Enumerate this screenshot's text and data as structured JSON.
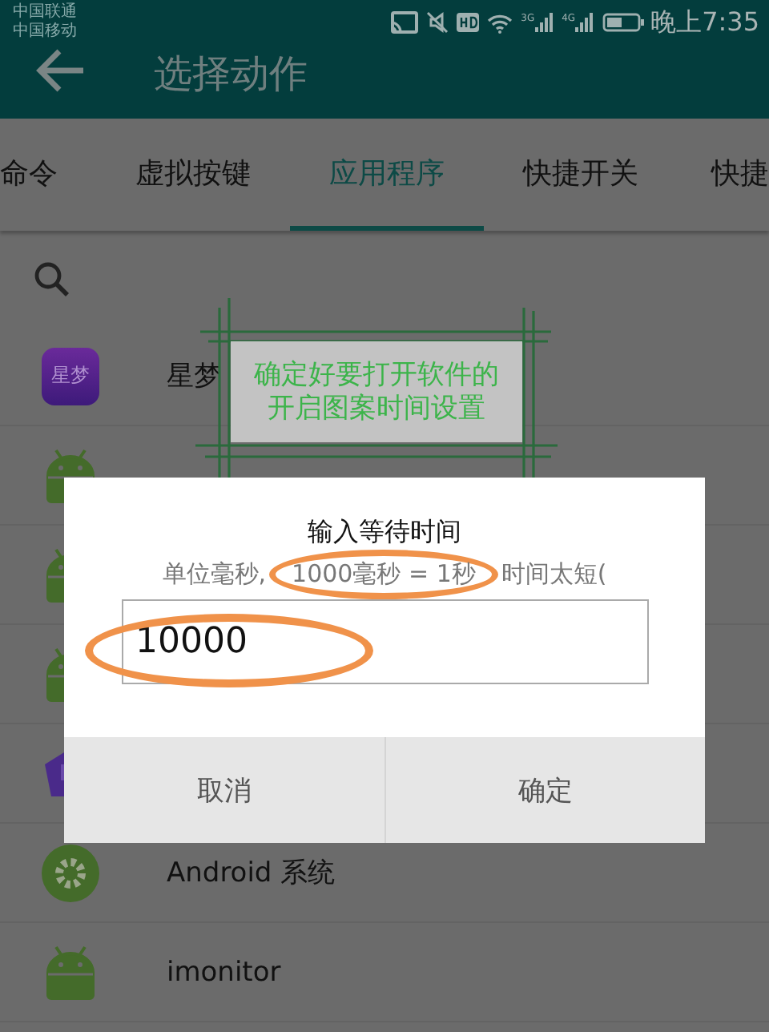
{
  "status_bar": {
    "carriers": [
      "中国联通",
      "中国移动"
    ],
    "network_labels": [
      "3G",
      "4G"
    ],
    "time": "晚上7:35"
  },
  "app_bar": {
    "title": "选择动作"
  },
  "tabs": [
    {
      "label": "命令",
      "selected": false
    },
    {
      "label": "虚拟按键",
      "selected": false
    },
    {
      "label": "应用程序",
      "selected": true
    },
    {
      "label": "快捷开关",
      "selected": false
    },
    {
      "label": "快捷",
      "selected": false
    }
  ],
  "apps": [
    {
      "kind": "logo",
      "icon_text": "星梦",
      "label": "星梦"
    },
    {
      "kind": "android"
    },
    {
      "kind": "android"
    },
    {
      "kind": "android"
    },
    {
      "kind": "purple"
    },
    {
      "kind": "settings",
      "label": "Android 系统"
    },
    {
      "kind": "android",
      "label": "imonitor"
    }
  ],
  "dialog": {
    "title": "输入等待时间",
    "message": [
      {
        "text": "单位毫秒,",
        "highlighted": false
      },
      {
        "text": "1000毫秒 = 1秒",
        "highlighted": true
      },
      {
        "text": "时间太短(",
        "highlighted": false
      }
    ],
    "value": "10000",
    "value_highlighted": true,
    "buttons": [
      "取消",
      "确定"
    ]
  },
  "callout": {
    "lines": [
      "确定好要打开软件的",
      "开启图案时间设置"
    ]
  }
}
